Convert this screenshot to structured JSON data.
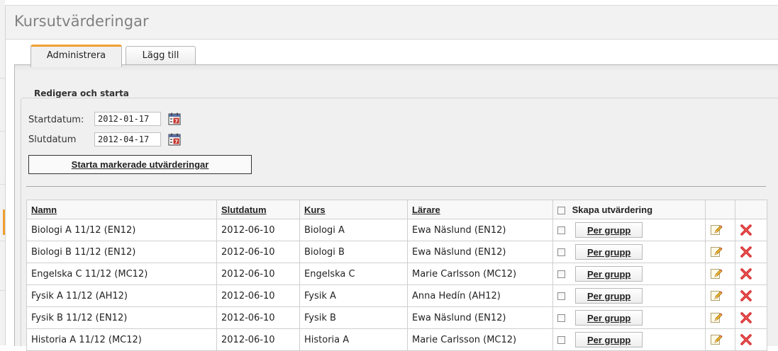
{
  "page": {
    "title": "Kursutvärderingar"
  },
  "tabs": [
    {
      "label": "Administrera",
      "active": true
    },
    {
      "label": "Lägg till",
      "active": false
    }
  ],
  "section": {
    "title": "Redigera och starta"
  },
  "form": {
    "start_label": "Startdatum:",
    "start_value": "2012-01-17",
    "end_label": "Slutdatum",
    "end_value": "2012-04-17",
    "start_button": "Starta markerade utvärderingar"
  },
  "table": {
    "headers": {
      "name": "Namn",
      "enddate": "Slutdatum",
      "course": "Kurs",
      "teacher": "Lärare",
      "create": "Skapa utvärdering"
    },
    "per_group_label": "Per grupp",
    "rows": [
      {
        "name": "Biologi A 11/12 (EN12)",
        "enddate": "2012-06-10",
        "course": "Biologi A",
        "teacher": "Ewa Näslund (EN12)"
      },
      {
        "name": "Biologi B 11/12 (EN12)",
        "enddate": "2012-06-10",
        "course": "Biologi B",
        "teacher": "Ewa Näslund (EN12)"
      },
      {
        "name": "Engelska C 11/12 (MC12)",
        "enddate": "2012-06-10",
        "course": "Engelska C",
        "teacher": "Marie Carlsson (MC12)"
      },
      {
        "name": "Fysik A 11/12 (AH12)",
        "enddate": "2012-06-10",
        "course": "Fysik A",
        "teacher": "Anna Hedín (AH12)"
      },
      {
        "name": "Fysik B 11/12 (EN12)",
        "enddate": "2012-06-10",
        "course": "Fysik B",
        "teacher": "Ewa Näslund (EN12)"
      },
      {
        "name": "Historia A 11/12 (MC12)",
        "enddate": "2012-06-10",
        "course": "Historia A",
        "teacher": "Marie Carlsson (MC12)"
      }
    ]
  },
  "icons": {
    "calendar": "calendar-icon",
    "edit": "pencil-edit-icon",
    "delete": "red-x-delete-icon"
  },
  "colors": {
    "tab_accent": "#f0a030",
    "delete_red": "#d42a2a",
    "title_gray": "#808080"
  }
}
